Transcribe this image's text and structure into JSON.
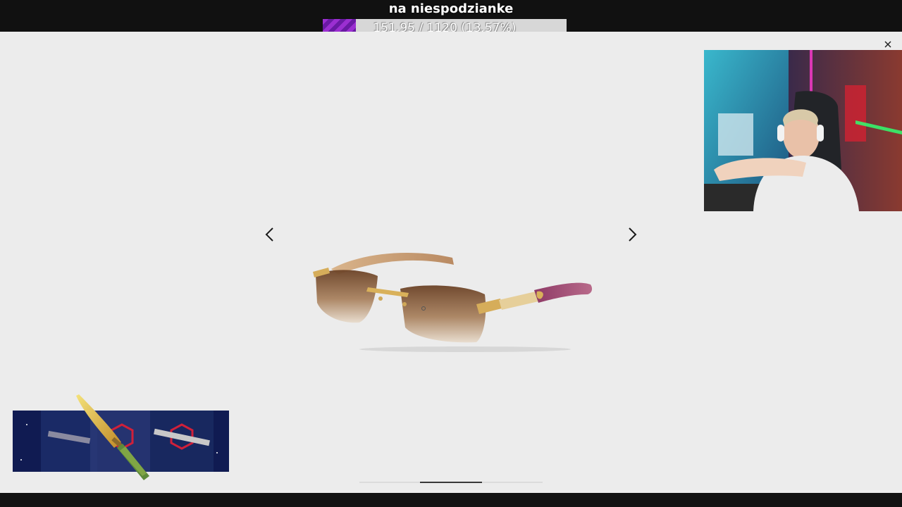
{
  "stream": {
    "goal": {
      "title": "na niespodzianke",
      "progress_text": "151.95 / 1120 (13.57%)",
      "current": 151.95,
      "target": 1120,
      "percent": 13.57,
      "fill_color": "#9b2fd1"
    }
  },
  "gallery": {
    "prev_icon": "chevron-left-icon",
    "next_icon": "chevron-right-icon",
    "close_icon": "close-icon",
    "image_subject": "rimless gradient brown sunglasses with gold and wood temples",
    "background_color": "#ececec",
    "carousel_position": "2 of 3"
  },
  "overlays": {
    "webcam": "streamer webcam",
    "inventory_preview": "weapon skins panel with knife"
  }
}
